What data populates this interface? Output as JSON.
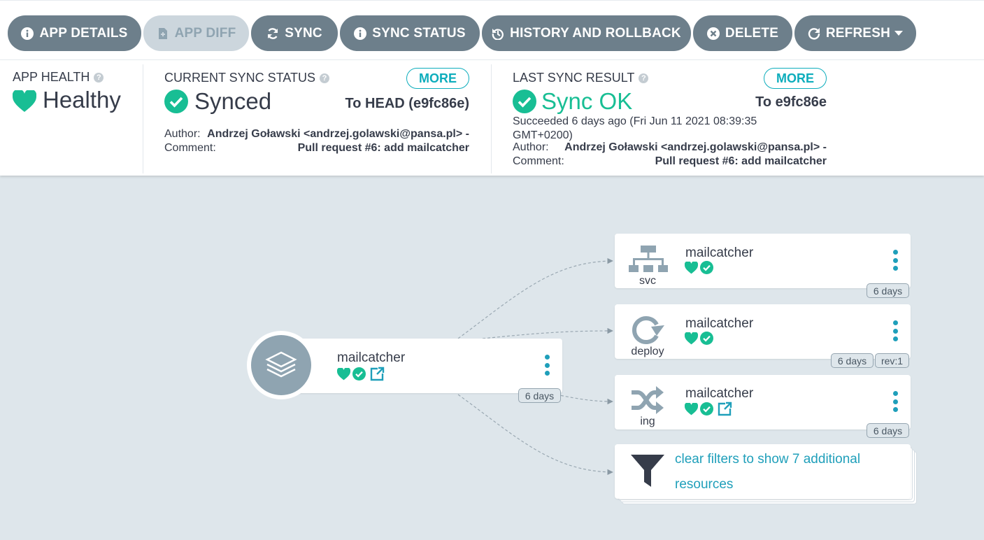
{
  "toolbar": {
    "buttons": [
      {
        "label": "APP DETAILS",
        "icon": "info-circle-icon"
      },
      {
        "label": "APP DIFF",
        "icon": "file-diff-icon",
        "disabled": true
      },
      {
        "label": "SYNC",
        "icon": "sync-icon"
      },
      {
        "label": "SYNC STATUS",
        "icon": "info-circle-icon"
      },
      {
        "label": "HISTORY AND ROLLBACK",
        "icon": "history-icon"
      },
      {
        "label": "DELETE",
        "icon": "times-circle-icon"
      },
      {
        "label": "REFRESH",
        "icon": "redo-icon"
      }
    ]
  },
  "health": {
    "title": "APP HEALTH",
    "value": "Healthy"
  },
  "current_sync": {
    "title": "CURRENT SYNC STATUS",
    "more": "MORE",
    "value": "Synced",
    "revision": "To HEAD (e9fc86e)",
    "author_label": "Author:",
    "author": "Andrzej Goławski <andrzej.golawski@pansa.pl> -",
    "comment_label": "Comment:",
    "comment": "Pull request #6: add mailcatcher"
  },
  "last_sync": {
    "title": "LAST SYNC RESULT",
    "more": "MORE",
    "value": "Sync OK",
    "revision": "To e9fc86e",
    "succeeded": "Succeeded 6 days ago (Fri Jun 11 2021 08:39:35 GMT+0200)",
    "author_label": "Author:",
    "author": "Andrzej Goławski <andrzej.golawski@pansa.pl> -",
    "comment_label": "Comment:",
    "comment": "Pull request #6: add mailcatcher"
  },
  "graph": {
    "app": {
      "name": "mailcatcher",
      "age": "6 days"
    },
    "resources": [
      {
        "kind": "svc",
        "name": "mailcatcher",
        "age": "6 days",
        "icon": "network-tree-icon"
      },
      {
        "kind": "deploy",
        "name": "mailcatcher",
        "age": "6 days",
        "rev": "rev:1",
        "icon": "rotate-icon"
      },
      {
        "kind": "ing",
        "name": "mailcatcher",
        "age": "6 days",
        "icon": "shuffle-icon"
      }
    ],
    "filtered": {
      "text": "clear filters to show 7 additional resources",
      "icon": "filter-icon"
    }
  },
  "colors": {
    "healthy": "#18be94",
    "accent": "#0dadbc",
    "button": "#6d7f8b",
    "node_icon": "#8fa4b1"
  }
}
